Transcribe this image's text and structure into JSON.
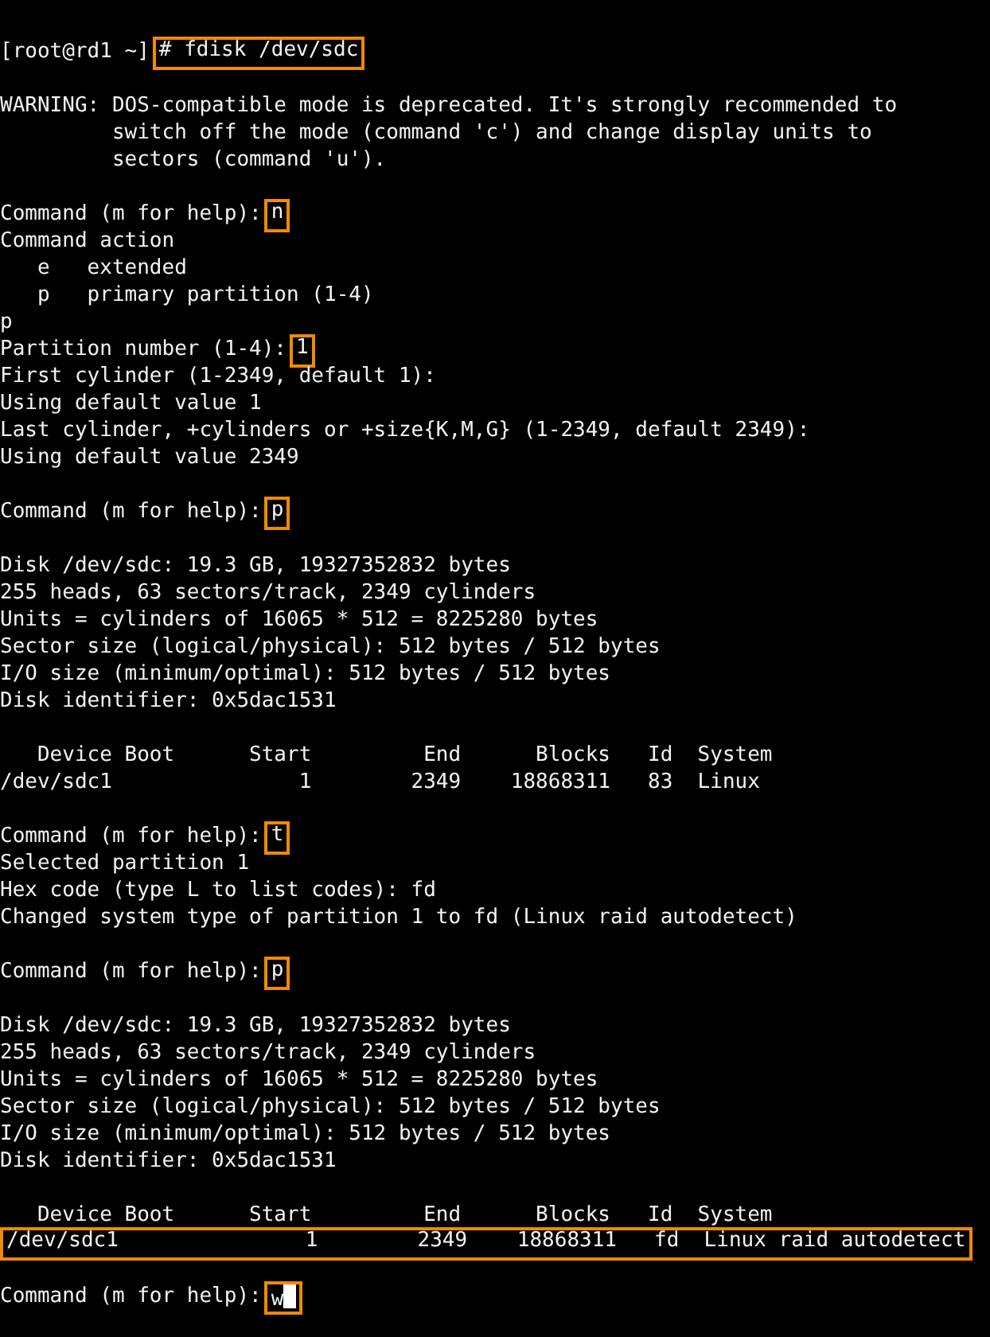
{
  "terminal": {
    "lines": [
      {
        "kind": "text",
        "segments": [
          {
            "text": "[root@rd1 ~]",
            "highlight": false
          },
          {
            "text": "# fdisk /dev/sdc",
            "highlight": true
          }
        ]
      },
      {
        "kind": "blank"
      },
      {
        "kind": "text",
        "segments": [
          {
            "text": "WARNING: DOS-compatible mode is deprecated. It's strongly recommended to",
            "highlight": false
          }
        ]
      },
      {
        "kind": "text",
        "segments": [
          {
            "text": "         switch off the mode (command 'c') and change display units to",
            "highlight": false
          }
        ]
      },
      {
        "kind": "text",
        "segments": [
          {
            "text": "         sectors (command 'u').",
            "highlight": false
          }
        ]
      },
      {
        "kind": "blank"
      },
      {
        "kind": "text",
        "segments": [
          {
            "text": "Command (m for help):",
            "highlight": false
          },
          {
            "text": "n",
            "highlight": true
          }
        ]
      },
      {
        "kind": "text",
        "segments": [
          {
            "text": "Command action",
            "highlight": false
          }
        ]
      },
      {
        "kind": "text",
        "segments": [
          {
            "text": "   e   extended",
            "highlight": false
          }
        ]
      },
      {
        "kind": "text",
        "segments": [
          {
            "text": "   p   primary partition (1-4)",
            "highlight": false
          }
        ]
      },
      {
        "kind": "text",
        "segments": [
          {
            "text": "p",
            "highlight": false
          }
        ]
      },
      {
        "kind": "text",
        "segments": [
          {
            "text": "Partition number (1-4):",
            "highlight": false
          },
          {
            "text": "1",
            "highlight": true
          }
        ]
      },
      {
        "kind": "text",
        "segments": [
          {
            "text": "First cylinder (1-2349, default 1):",
            "highlight": false
          }
        ]
      },
      {
        "kind": "text",
        "segments": [
          {
            "text": "Using default value 1",
            "highlight": false
          }
        ]
      },
      {
        "kind": "text",
        "segments": [
          {
            "text": "Last cylinder, +cylinders or +size{K,M,G} (1-2349, default 2349):",
            "highlight": false
          }
        ]
      },
      {
        "kind": "text",
        "segments": [
          {
            "text": "Using default value 2349",
            "highlight": false
          }
        ]
      },
      {
        "kind": "blank"
      },
      {
        "kind": "text",
        "segments": [
          {
            "text": "Command (m for help):",
            "highlight": false
          },
          {
            "text": "p",
            "highlight": true
          }
        ]
      },
      {
        "kind": "blank"
      },
      {
        "kind": "text",
        "segments": [
          {
            "text": "Disk /dev/sdc: 19.3 GB, 19327352832 bytes",
            "highlight": false
          }
        ]
      },
      {
        "kind": "text",
        "segments": [
          {
            "text": "255 heads, 63 sectors/track, 2349 cylinders",
            "highlight": false
          }
        ]
      },
      {
        "kind": "text",
        "segments": [
          {
            "text": "Units = cylinders of 16065 * 512 = 8225280 bytes",
            "highlight": false
          }
        ]
      },
      {
        "kind": "text",
        "segments": [
          {
            "text": "Sector size (logical/physical): 512 bytes / 512 bytes",
            "highlight": false
          }
        ]
      },
      {
        "kind": "text",
        "segments": [
          {
            "text": "I/O size (minimum/optimal): 512 bytes / 512 bytes",
            "highlight": false
          }
        ]
      },
      {
        "kind": "text",
        "segments": [
          {
            "text": "Disk identifier: 0x5dac1531",
            "highlight": false
          }
        ]
      },
      {
        "kind": "blank"
      },
      {
        "kind": "text",
        "segments": [
          {
            "text": "   Device Boot      Start         End      Blocks   Id  System",
            "highlight": false
          }
        ]
      },
      {
        "kind": "text",
        "segments": [
          {
            "text": "/dev/sdc1               1        2349    18868311   83  Linux",
            "highlight": false
          }
        ]
      },
      {
        "kind": "blank"
      },
      {
        "kind": "text",
        "segments": [
          {
            "text": "Command (m for help):",
            "highlight": false
          },
          {
            "text": "t",
            "highlight": true
          }
        ]
      },
      {
        "kind": "text",
        "segments": [
          {
            "text": "Selected partition 1",
            "highlight": false
          }
        ]
      },
      {
        "kind": "text",
        "segments": [
          {
            "text": "Hex code (type L to list codes): fd",
            "highlight": false
          }
        ]
      },
      {
        "kind": "text",
        "segments": [
          {
            "text": "Changed system type of partition 1 to fd (Linux raid autodetect)",
            "highlight": false
          }
        ]
      },
      {
        "kind": "blank"
      },
      {
        "kind": "text",
        "segments": [
          {
            "text": "Command (m for help):",
            "highlight": false
          },
          {
            "text": "p",
            "highlight": true
          }
        ]
      },
      {
        "kind": "blank"
      },
      {
        "kind": "text",
        "segments": [
          {
            "text": "Disk /dev/sdc: 19.3 GB, 19327352832 bytes",
            "highlight": false
          }
        ]
      },
      {
        "kind": "text",
        "segments": [
          {
            "text": "255 heads, 63 sectors/track, 2349 cylinders",
            "highlight": false
          }
        ]
      },
      {
        "kind": "text",
        "segments": [
          {
            "text": "Units = cylinders of 16065 * 512 = 8225280 bytes",
            "highlight": false
          }
        ]
      },
      {
        "kind": "text",
        "segments": [
          {
            "text": "Sector size (logical/physical): 512 bytes / 512 bytes",
            "highlight": false
          }
        ]
      },
      {
        "kind": "text",
        "segments": [
          {
            "text": "I/O size (minimum/optimal): 512 bytes / 512 bytes",
            "highlight": false
          }
        ]
      },
      {
        "kind": "text",
        "segments": [
          {
            "text": "Disk identifier: 0x5dac1531",
            "highlight": false
          }
        ]
      },
      {
        "kind": "blank"
      },
      {
        "kind": "text",
        "segments": [
          {
            "text": "   Device Boot      Start         End      Blocks   Id  System",
            "highlight": false
          }
        ]
      },
      {
        "kind": "text",
        "segments": [
          {
            "text": "/dev/sdc1               1        2349    18868311   fd  Linux raid autodetect",
            "highlight": true
          }
        ]
      },
      {
        "kind": "blank"
      },
      {
        "kind": "text",
        "cursor": true,
        "segments": [
          {
            "text": "Command (m for help):",
            "highlight": false
          },
          {
            "text": "w",
            "highlight": true
          }
        ]
      }
    ]
  }
}
